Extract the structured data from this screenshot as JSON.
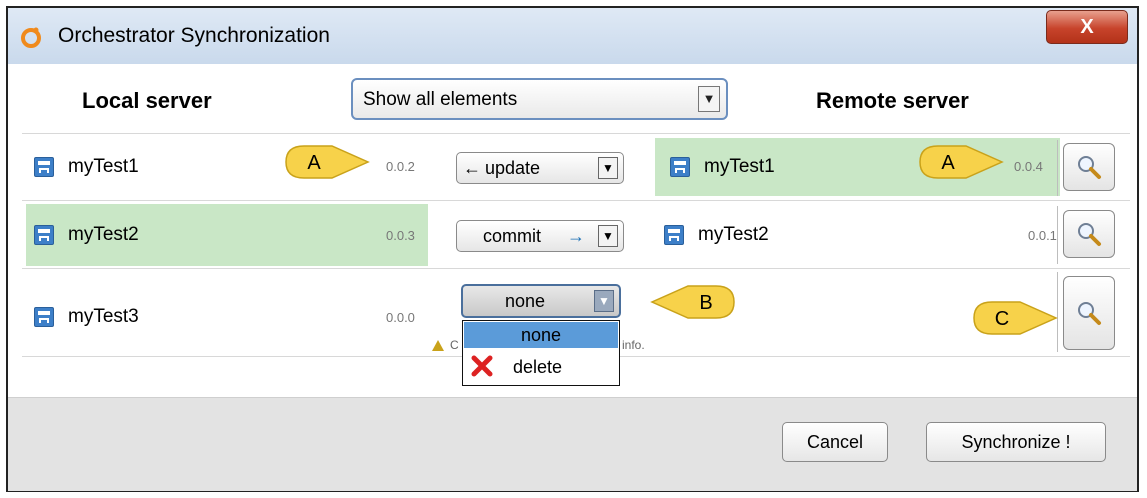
{
  "window": {
    "title": "Orchestrator Synchronization",
    "close_label": "X"
  },
  "headers": {
    "local": "Local server",
    "remote": "Remote server"
  },
  "filter": {
    "value": "Show all elements"
  },
  "rows": [
    {
      "local_name": "myTest1",
      "local_version": "0.0.2",
      "action": "update",
      "action_arrow": "←",
      "remote_name": "myTest1",
      "remote_version": "0.0.4",
      "highlight": "remote"
    },
    {
      "local_name": "myTest2",
      "local_version": "0.0.3",
      "action": "commit",
      "action_arrow": "→",
      "remote_name": "myTest2",
      "remote_version": "0.0.1",
      "highlight": "local"
    },
    {
      "local_name": "myTest3",
      "local_version": "0.0.0",
      "action": "none",
      "remote_name": "",
      "remote_version": "",
      "highlight": "none"
    }
  ],
  "dropdown_options": [
    {
      "label": "none",
      "icon": "",
      "selected": true
    },
    {
      "label": "delete",
      "icon": "red-x-icon",
      "selected": false
    }
  ],
  "warning_fragments": {
    "left": "C",
    "right": "info."
  },
  "callouts": {
    "a1": "A",
    "a2": "A",
    "b": "B",
    "c": "C"
  },
  "footer": {
    "cancel": "Cancel",
    "synchronize": "Synchronize !"
  },
  "colors": {
    "highlight_green": "#c9e7c6",
    "callout_yellow": "#f7d24a",
    "dropdown_selected": "#5b9bd9"
  }
}
